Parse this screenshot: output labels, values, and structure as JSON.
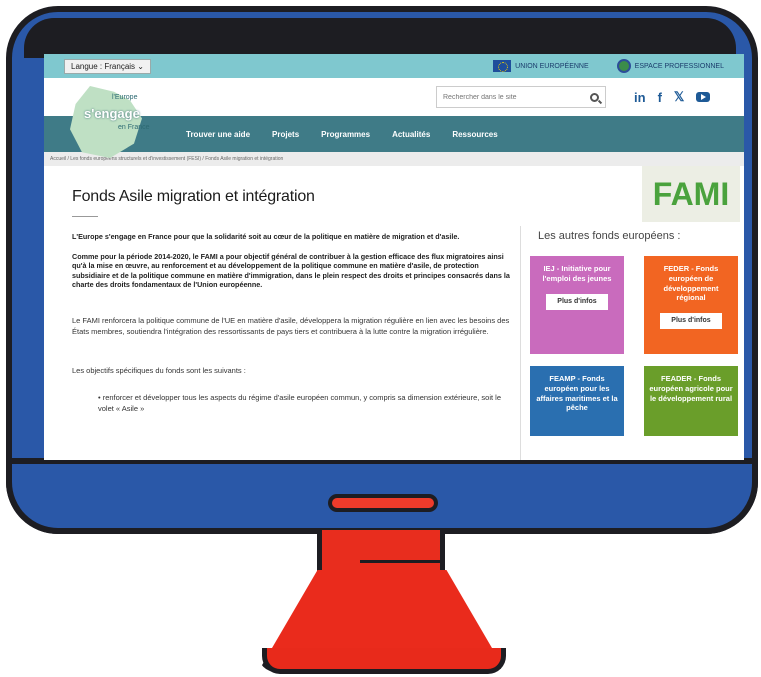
{
  "topbar": {
    "language_label": "Langue : Français ⌄",
    "eu_label": "Union européenne",
    "pro_label": "Espace professionnel"
  },
  "logo": {
    "sub1": "l'Europe",
    "main": "s'engage",
    "sub2": "en France"
  },
  "search": {
    "placeholder": "Rechercher dans le site"
  },
  "socials": [
    "in",
    "f",
    "𝕏"
  ],
  "nav": {
    "items": [
      "Trouver une aide",
      "Projets",
      "Programmes",
      "Actualités",
      "Ressources"
    ]
  },
  "breadcrumb": "Accueil / Les fonds européens structurels et d'investissement (FESI) / Fonds Asile migration et intégration",
  "page": {
    "title": "Fonds Asile migration et intégration",
    "badge": "FAMI",
    "lead": "L'Europe s'engage en France pour que la solidarité soit au cœur de la politique en matière de migration et d'asile.",
    "lead2": "Comme pour la période 2014-2020, le FAMI a pour objectif général de contribuer à la gestion efficace des flux migratoires ainsi qu'à la mise en œuvre, au renforcement et au développement de la politique commune en matière d'asile, de protection subsidiaire et de la politique commune en matière d'immigration, dans le plein respect des droits et principes consacrés dans la charte des droits fondamentaux de l'Union européenne.",
    "para": "Le FAMI renforcera la politique commune de l'UE en matière d'asile, développera la migration régulière en lien avec les besoins des États membres, soutiendra l'intégration des ressortissants de pays tiers et contribuera à la lutte contre la migration irrégulière.",
    "para2": "Les objectifs spécifiques du fonds sont les suivants :",
    "bullet": "• renforcer et développer tous les aspects du régime d'asile européen commun, y compris sa dimension extérieure, soit le volet « Asile »"
  },
  "aside": {
    "title": "Les autres fonds européens :",
    "cards": [
      {
        "label": "IEJ - Initiative pour l'emploi des jeunes",
        "button": "Plus d'infos",
        "color": "#c96bbd"
      },
      {
        "label": "FEDER - Fonds européen de développement régional",
        "button": "Plus d'infos",
        "color": "#f26522"
      },
      {
        "label": "FEAMP - Fonds européen pour les affaires maritimes et la pêche",
        "color": "#2a6fb0"
      },
      {
        "label": "FEADER - Fonds européen agricole pour le développement rural",
        "color": "#6a9e2a"
      }
    ]
  }
}
